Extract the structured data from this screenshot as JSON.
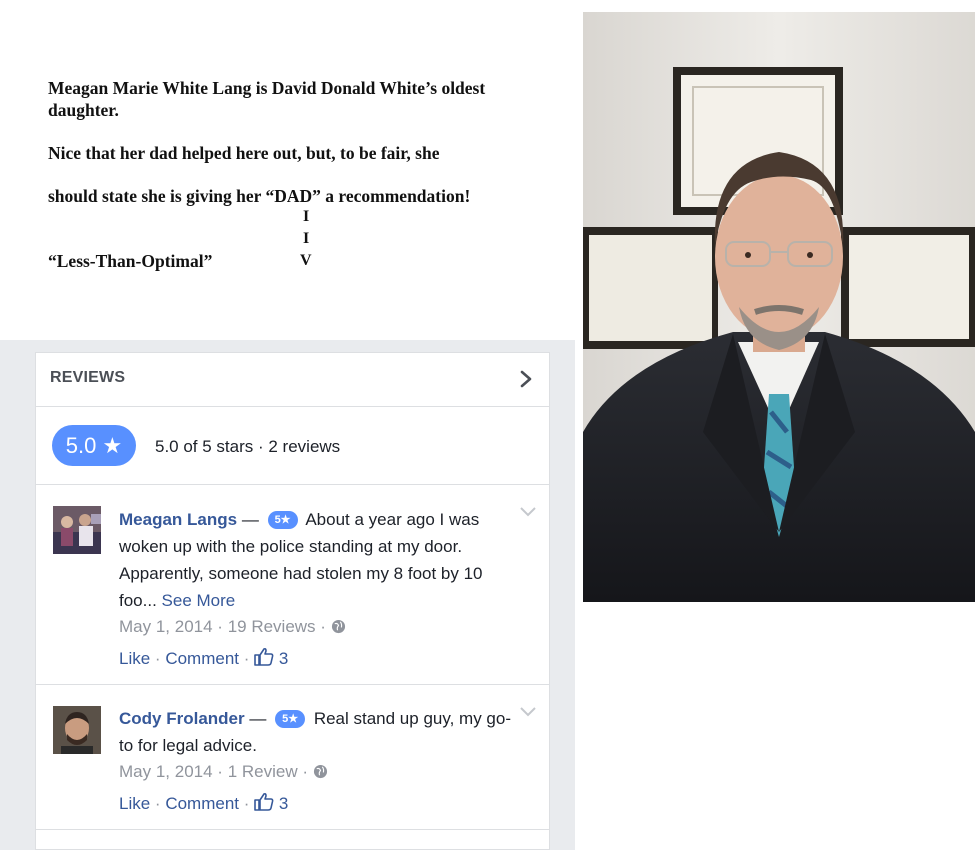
{
  "note": {
    "line1": "Meagan Marie White Lang is David Donald White’s oldest",
    "line2": "daughter.",
    "line3": "Nice that her dad helped here out, but, to be fair, she",
    "line4": "should state she is giving her “DAD” a recommendation!",
    "arrow1": "I",
    "arrow2": "I",
    "arrow3": "V",
    "label": "“Less-Than-Optimal”"
  },
  "reviews_panel": {
    "title": "REVIEWS",
    "rating_pill": "5.0 ★",
    "rating_summary": "5.0 of 5 stars · 2 reviews",
    "items": [
      {
        "name": "Meagan Langs",
        "dash": "—",
        "badge": "5★",
        "text": "About a year ago I was woken up with the police standing at my door. Apparently, someone had stolen my 8 foot by 10 foo...",
        "see_more": "See More",
        "date": "May 1, 2014",
        "review_count": "19 Reviews",
        "like": "Like",
        "comment": "Comment",
        "likes": "3"
      },
      {
        "name": "Cody Frolander",
        "dash": "—",
        "badge": "5★",
        "text": "Real stand up guy, my go-to for legal advice.",
        "date": "May 1, 2014",
        "review_count": "1 Review",
        "like": "Like",
        "comment": "Comment",
        "likes": "3"
      }
    ]
  },
  "colors": {
    "link": "#365899",
    "accent": "#5890ff",
    "muted": "#90949c",
    "panel_bg": "#e9ebee"
  }
}
